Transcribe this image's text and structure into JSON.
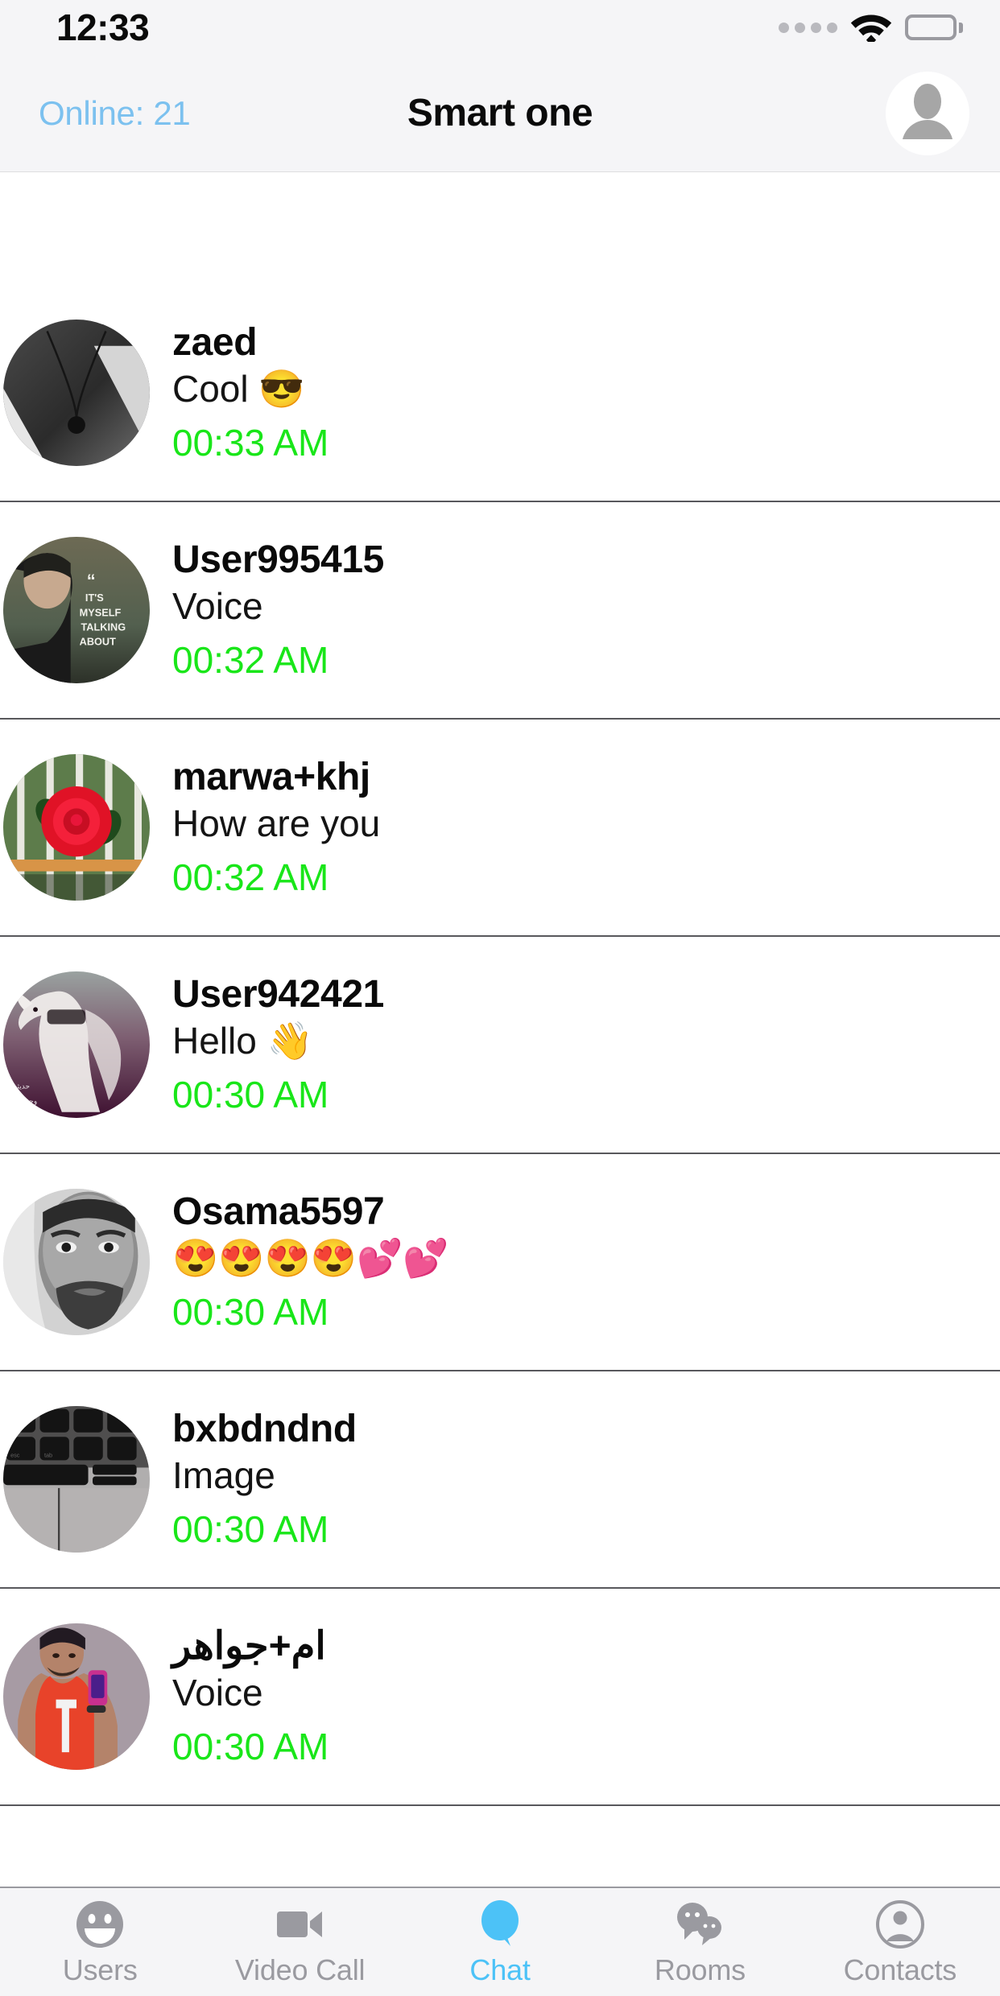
{
  "status_bar": {
    "time": "12:33",
    "signal_icon": "signal-dots-icon",
    "wifi_icon": "wifi-icon",
    "battery_icon": "battery-full-icon"
  },
  "header": {
    "online_label": "Online: 21",
    "title": "Smart one",
    "avatar_icon": "default-user-avatar"
  },
  "chat_list": {
    "rows": [
      {
        "name": "zaed",
        "message": "Cool 😎",
        "time": "00:33 AM",
        "avatar": "photo-necklace-bw"
      },
      {
        "name": "User995415",
        "message": "Voice",
        "time": "00:32 AM",
        "avatar": "photo-man-quote"
      },
      {
        "name": "marwa+khj",
        "message": "How are you",
        "time": "00:32 AM",
        "avatar": "photo-red-rose"
      },
      {
        "name": "User942421",
        "message": "Hello 👋",
        "time": "00:30 AM",
        "avatar": "photo-white-horse"
      },
      {
        "name": "Osama5597",
        "message": "😍😍😍😍💕💕",
        "time": "00:30 AM",
        "avatar": "photo-man-bw-face"
      },
      {
        "name": "bxbdndnd",
        "message": "Image",
        "time": "00:30 AM",
        "avatar": "photo-laptop-keyboard"
      },
      {
        "name": "ام+جواهر",
        "message": "Voice",
        "time": "00:30 AM",
        "avatar": "photo-man-red-tank"
      }
    ]
  },
  "tab_bar": {
    "active": "Chat",
    "items": [
      {
        "label": "Users",
        "icon": "smiley-face-icon"
      },
      {
        "label": "Video Call",
        "icon": "video-camera-icon"
      },
      {
        "label": "Chat",
        "icon": "speech-bubble-icon"
      },
      {
        "label": "Rooms",
        "icon": "two-speech-bubbles-icon"
      },
      {
        "label": "Contacts",
        "icon": "person-circle-icon"
      }
    ]
  },
  "colors": {
    "accent_blue": "#4cc2f7",
    "online_blue": "#7cc1ef",
    "time_green": "#19e619",
    "bar_background": "#f5f5f7",
    "inactive_gray": "#9a9aa0"
  }
}
